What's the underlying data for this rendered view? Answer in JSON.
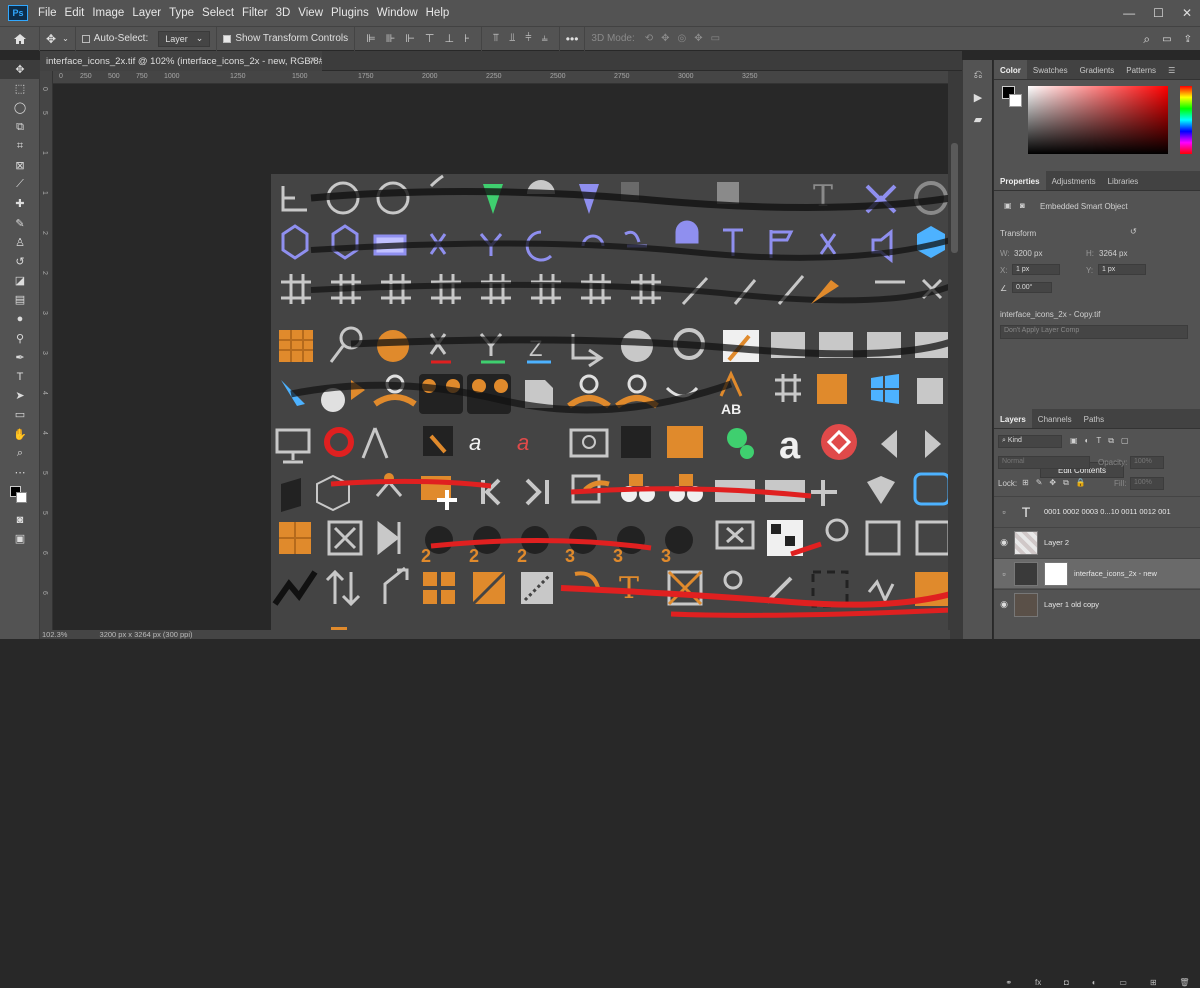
{
  "app": {
    "logo": "Ps"
  },
  "menu": [
    "File",
    "Edit",
    "Image",
    "Layer",
    "Type",
    "Select",
    "Filter",
    "3D",
    "View",
    "Plugins",
    "Window",
    "Help"
  ],
  "window_controls": [
    "—",
    "☐",
    "✕"
  ],
  "options": {
    "auto_select_label": "Auto-Select:",
    "auto_select_value": "Layer",
    "show_transform_label": "Show Transform Controls",
    "three_d_mode": "3D Mode:",
    "more": "•••"
  },
  "document_tab": {
    "title": "interface_icons_2x.tif @ 102% (interface_icons_2x - new, RGB/8#) *"
  },
  "ruler_h": [
    "0",
    "250",
    "500",
    "750",
    "1000",
    "1250",
    "1500",
    "1750",
    "2000",
    "2250",
    "2500",
    "2750",
    "3000",
    "3250"
  ],
  "ruler_v": [
    "0",
    "5",
    "1",
    "1",
    "2",
    "2",
    "3",
    "3",
    "4",
    "4",
    "5",
    "5",
    "6",
    "6"
  ],
  "status": {
    "zoom": "102.3%",
    "size": "3200 px x 3264 px (300 ppi)"
  },
  "panels": {
    "color_tabs": [
      "Color",
      "Swatches",
      "Gradients",
      "Patterns"
    ],
    "props_tabs": [
      "Properties",
      "Adjustments",
      "Libraries"
    ],
    "props": {
      "object_type": "Embedded Smart Object",
      "transform": "Transform",
      "w_label": "W:",
      "w_value": "3200 px",
      "h_label": "H:",
      "h_value": "3264 px",
      "x_label": "X:",
      "x_value": "1 px",
      "y_label": "Y:",
      "y_value": "1 px",
      "angle_value": "0.00°",
      "file": "interface_icons_2x - Copy.tif",
      "layer_comp": "Don't Apply Layer Comp",
      "edit_contents": "Edit Contents"
    },
    "layers_tabs": [
      "Layers",
      "Channels",
      "Paths"
    ],
    "layers": {
      "kind": "Kind",
      "blend": "Normal",
      "opacity_label": "Opacity:",
      "opacity": "100%",
      "lock_label": "Lock:",
      "fill_label": "Fill:",
      "fill": "100%",
      "items": [
        {
          "name": "0001 0002 0003 0...10 0011 0012 001",
          "visible": false,
          "type": "text"
        },
        {
          "name": "Layer 2",
          "visible": true,
          "type": "pixel"
        },
        {
          "name": "interface_icons_2x - new",
          "visible": false,
          "type": "smart"
        },
        {
          "name": "Layer 1 old copy",
          "visible": true,
          "type": "pixel"
        }
      ]
    }
  },
  "colors": {
    "accent_orange": "#e08a2c",
    "icon_purple": "#8f8fef",
    "icon_green": "#3fcf6f",
    "icon_red": "#e02020",
    "icon_blue": "#4db2ff",
    "canvas_bg": "#444444"
  }
}
